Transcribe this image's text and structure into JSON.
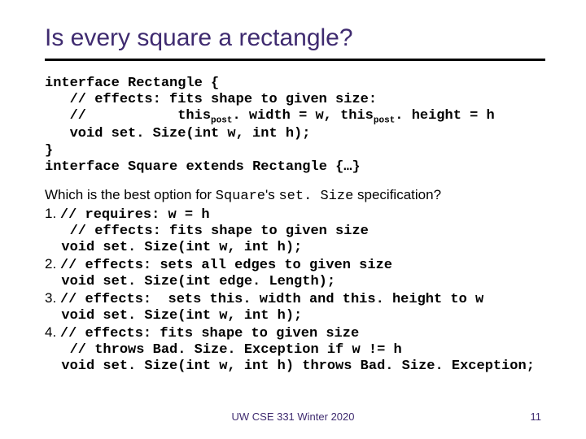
{
  "title": "Is every square a rectangle?",
  "code": {
    "l1a": "interface ",
    "l1b": "Rectangle",
    "l1c": " {",
    "l2": "   // effects: fits shape to given size:",
    "l3a": "   //           this",
    "l3b": "post",
    "l3c": ". width = w, this",
    "l3d": "post",
    "l3e": ". height = h",
    "l4": "   void set. Size(int w, int h);",
    "l5": "}",
    "l6a": "interface ",
    "l6b": "Square",
    "l6c": " extends ",
    "l6d": "Rectangle",
    "l6e": " {…}"
  },
  "question_a": "Which is the best option for ",
  "question_b": "Square",
  "question_c": "'s ",
  "question_d": "set. Size",
  "question_e": "  specification?",
  "opts": {
    "n1": "1. ",
    "o1a": "// requires: w = h",
    "o1b": "   // effects: fits shape to given size",
    "o1c": "  void set. Size(int w, int h);",
    "n2": "2. ",
    "o2a": "// effects: sets all edges to given size",
    "o2b": "  void set. Size(int edge. Length);",
    "n3": "3. ",
    "o3a": "// effects:  sets this. width and this. height to w",
    "o3b": "  void set. Size(int w, int h);",
    "n4": "4. ",
    "o4a": "// effects: fits shape to given size",
    "o4b": "   // throws Bad. Size. Exception if w != h",
    "o4c": "  void set. Size(int w, int h) throws Bad. Size. Exception;"
  },
  "footer": "UW CSE 331 Winter 2020",
  "page": "11"
}
